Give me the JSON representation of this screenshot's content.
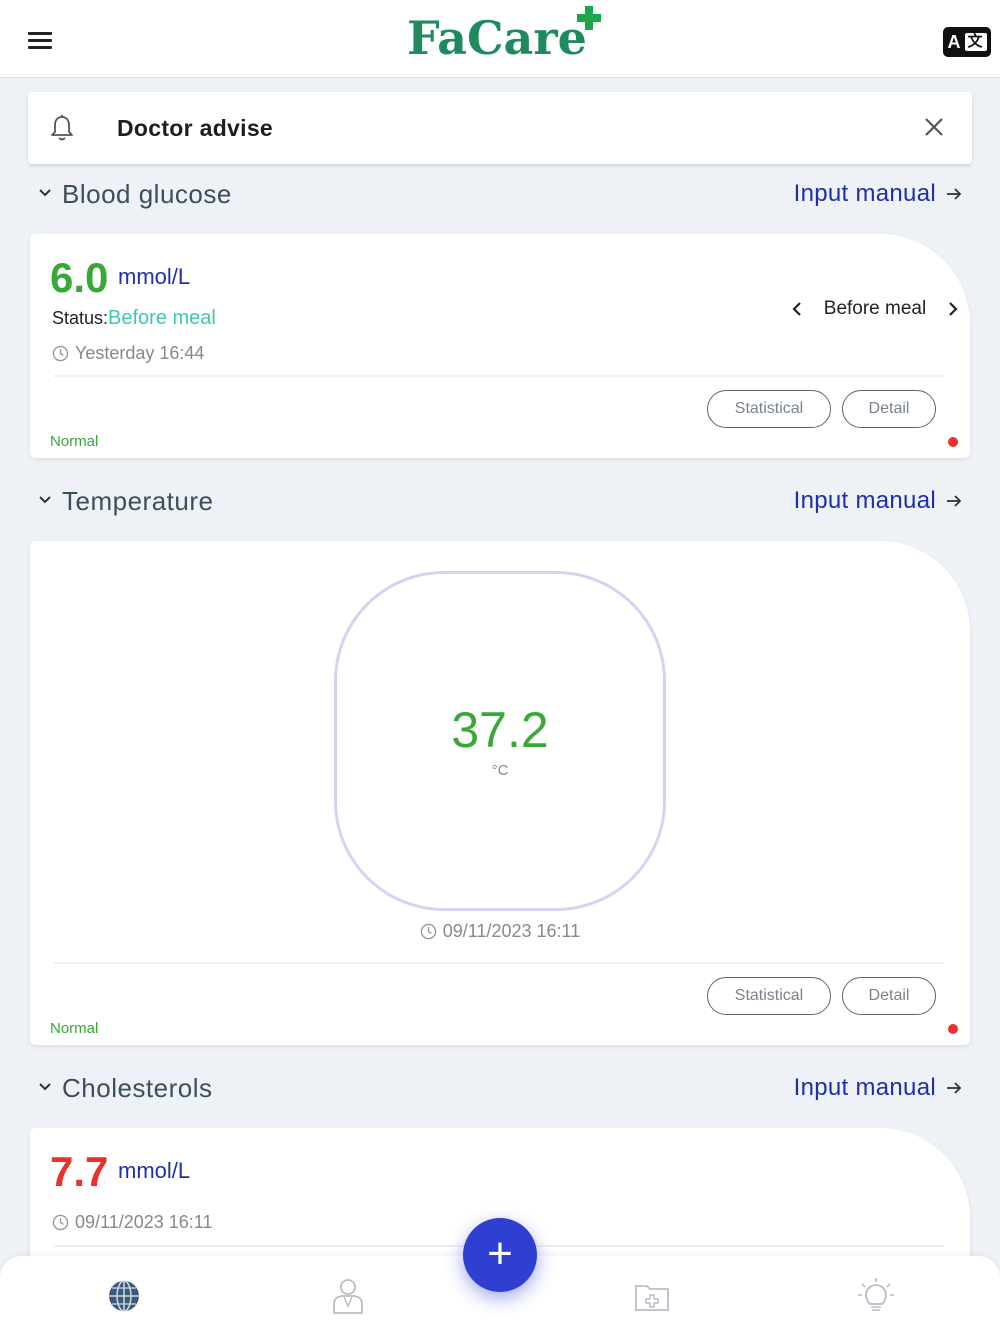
{
  "header": {
    "logo_text": "FaCare",
    "lang_label": "A",
    "lang_label_inv": "文"
  },
  "advise": {
    "title": "Doctor advise"
  },
  "sections": {
    "glucose": {
      "title": "Blood glucose",
      "link": "Input manual",
      "value": "6.0",
      "value_color": "#3aa836",
      "unit": "mmol/L",
      "status_label": "Status:",
      "status_value": "Before meal",
      "time": "Yesterday 16:44",
      "meal_selector": "Before meal",
      "btn_stat": "Statistical",
      "btn_detail": "Detail",
      "level": "Normal"
    },
    "temperature": {
      "title": "Temperature",
      "link": "Input manual",
      "value": "37.2",
      "unit": "°C",
      "time": "09/11/2023 16:11",
      "btn_stat": "Statistical",
      "btn_detail": "Detail",
      "level": "Normal"
    },
    "cholesterol": {
      "title": "Cholesterols",
      "link": "Input manual",
      "value": "7.7",
      "value_color": "#e8322a",
      "unit": "mmol/L",
      "time": "09/11/2023 16:11"
    }
  },
  "fab": {
    "label": "+"
  },
  "colors": {
    "brand": "#1e8a5e",
    "accent": "#2f3fd0",
    "link": "#1f2fa8",
    "normal": "#3aa836",
    "alert": "#e8322a"
  },
  "nav": {
    "items": [
      "globe-icon",
      "doctor-icon",
      "medical-folder-icon",
      "lightbulb-icon"
    ]
  }
}
